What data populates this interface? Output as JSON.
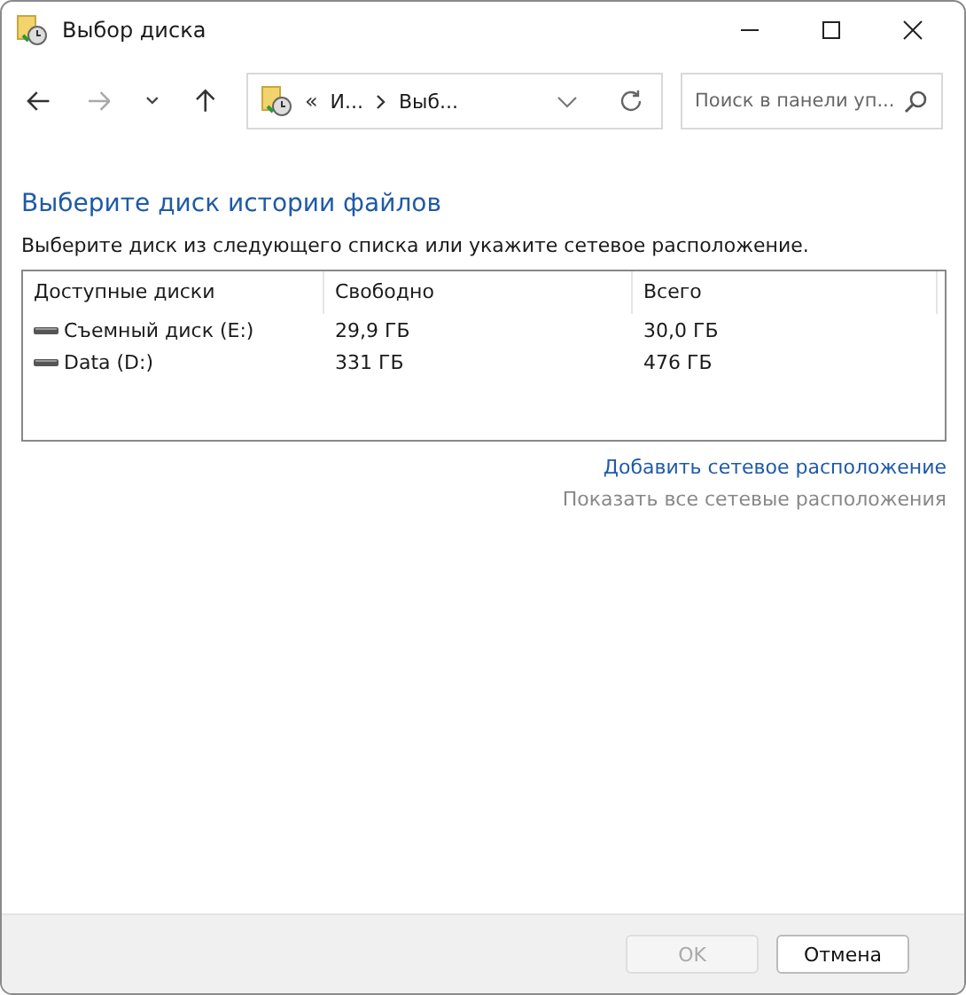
{
  "window": {
    "title": "Выбор диска"
  },
  "nav": {
    "back_disabled": false,
    "forward_disabled": true
  },
  "address": {
    "overflow": "«",
    "crumbs": [
      "И...",
      "Выб..."
    ]
  },
  "search": {
    "placeholder": "Поиск в панели уп..."
  },
  "heading": "Выберите диск истории файлов",
  "instruction": "Выберите диск из следующего списка или укажите сетевое расположение.",
  "table": {
    "columns": [
      "Доступные диски",
      "Свободно",
      "Всего"
    ],
    "rows": [
      {
        "name": "Съемный диск (E:)",
        "free": "29,9 ГБ",
        "total": "30,0 ГБ",
        "selected": false
      },
      {
        "name": "Data (D:)",
        "free": "331 ГБ",
        "total": "476 ГБ",
        "selected": false
      }
    ]
  },
  "links": [
    {
      "label": "Добавить сетевое расположение",
      "disabled": false
    },
    {
      "label": "Показать все сетевые расположения",
      "disabled": true
    }
  ],
  "buttons": [
    {
      "label": "OK",
      "disabled": true
    },
    {
      "label": "Отмена",
      "disabled": false
    }
  ]
}
